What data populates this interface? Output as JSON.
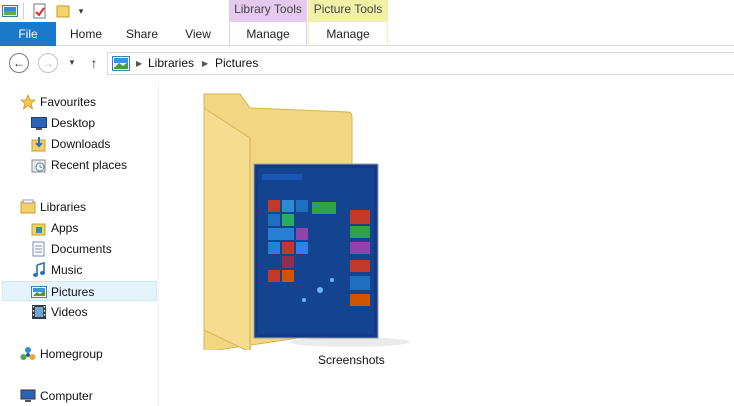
{
  "contextual": {
    "library_tools": "Library Tools",
    "picture_tools": "Picture Tools"
  },
  "ribbon": {
    "file": "File",
    "home": "Home",
    "share": "Share",
    "view": "View",
    "library_manage": "Manage",
    "picture_manage": "Manage"
  },
  "address": {
    "crumbs": [
      "Libraries",
      "Pictures"
    ]
  },
  "nav": {
    "favourites": {
      "label": "Favourites",
      "items": [
        "Desktop",
        "Downloads",
        "Recent places"
      ]
    },
    "libraries": {
      "label": "Libraries",
      "items": [
        "Apps",
        "Documents",
        "Music",
        "Pictures",
        "Videos"
      ]
    },
    "homegroup": "Homegroup",
    "computer": "Computer"
  },
  "content": {
    "folders": [
      {
        "name": "Screenshots"
      }
    ]
  },
  "colors": {
    "file_tab": "#1979ca",
    "library_tools": "#e6c9ef",
    "picture_tools": "#f2f0a6",
    "selection": "#e5f3fb"
  }
}
